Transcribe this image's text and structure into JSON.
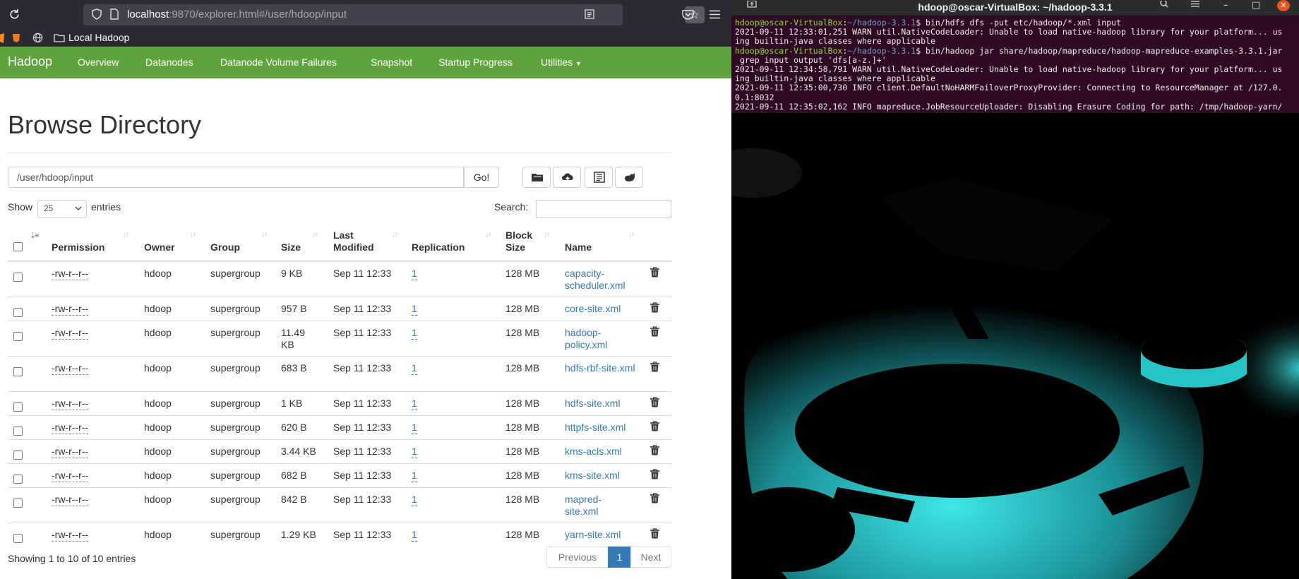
{
  "browser": {
    "url_host": "localhost",
    "url_rest": ":9870/explorer.html#/user/hdoop/input",
    "bookmark_label": "Local Hadoop"
  },
  "nav": {
    "brand": "Hadoop",
    "links": [
      "Overview",
      "Datanodes",
      "Datanode Volume Failures",
      "Snapshot",
      "Startup Progress",
      "Utilities"
    ]
  },
  "page": {
    "title": "Browse Directory",
    "path_value": "/user/hdoop/input",
    "go_label": "Go!",
    "show_label": "Show",
    "entries_select_value": "25",
    "entries_label": "entries",
    "search_label": "Search:"
  },
  "table": {
    "headers": [
      "Permission",
      "Owner",
      "Group",
      "Size",
      "Last Modified",
      "Replication",
      "Block Size",
      "Name"
    ],
    "rows": [
      {
        "permission": "-rw-r--r--",
        "owner": "hdoop",
        "group": "supergroup",
        "size": "9 KB",
        "modified": "Sep 11 12:33",
        "replication": "1",
        "block_size": "128 MB",
        "name": "capacity-scheduler.xml"
      },
      {
        "permission": "-rw-r--r--",
        "owner": "hdoop",
        "group": "supergroup",
        "size": "957 B",
        "modified": "Sep 11 12:33",
        "replication": "1",
        "block_size": "128 MB",
        "name": "core-site.xml"
      },
      {
        "permission": "-rw-r--r--",
        "owner": "hdoop",
        "group": "supergroup",
        "size": "11.49 KB",
        "modified": "Sep 11 12:33",
        "replication": "1",
        "block_size": "128 MB",
        "name": "hadoop-policy.xml"
      },
      {
        "permission": "-rw-r--r--",
        "owner": "hdoop",
        "group": "supergroup",
        "size": "683 B",
        "modified": "Sep 11 12:33",
        "replication": "1",
        "block_size": "128 MB",
        "name": "hdfs-rbf-site.xml"
      },
      {
        "permission": "-rw-r--r--",
        "owner": "hdoop",
        "group": "supergroup",
        "size": "1 KB",
        "modified": "Sep 11 12:33",
        "replication": "1",
        "block_size": "128 MB",
        "name": "hdfs-site.xml"
      },
      {
        "permission": "-rw-r--r--",
        "owner": "hdoop",
        "group": "supergroup",
        "size": "620 B",
        "modified": "Sep 11 12:33",
        "replication": "1",
        "block_size": "128 MB",
        "name": "httpfs-site.xml"
      },
      {
        "permission": "-rw-r--r--",
        "owner": "hdoop",
        "group": "supergroup",
        "size": "3.44 KB",
        "modified": "Sep 11 12:33",
        "replication": "1",
        "block_size": "128 MB",
        "name": "kms-acls.xml"
      },
      {
        "permission": "-rw-r--r--",
        "owner": "hdoop",
        "group": "supergroup",
        "size": "682 B",
        "modified": "Sep 11 12:33",
        "replication": "1",
        "block_size": "128 MB",
        "name": "kms-site.xml"
      },
      {
        "permission": "-rw-r--r--",
        "owner": "hdoop",
        "group": "supergroup",
        "size": "842 B",
        "modified": "Sep 11 12:33",
        "replication": "1",
        "block_size": "128 MB",
        "name": "mapred-site.xml"
      },
      {
        "permission": "-rw-r--r--",
        "owner": "hdoop",
        "group": "supergroup",
        "size": "1.29 KB",
        "modified": "Sep 11 12:33",
        "replication": "1",
        "block_size": "128 MB",
        "name": "yarn-site.xml"
      }
    ]
  },
  "footer": {
    "info": "Showing 1 to 10 of 10 entries",
    "prev": "Previous",
    "page": "1",
    "next": "Next"
  },
  "terminal": {
    "title": "hdoop@oscar-VirtualBox: ~/hadoop-3.3.1",
    "prompt_user": "hdoop@oscar-VirtualBox",
    "prompt_path": "~/hadoop-3.3.1",
    "cmd1": "$ bin/hdfs dfs -put etc/hadoop/*.xml input",
    "out1": "2021-09-11 12:33:01,251 WARN util.NativeCodeLoader: Unable to load native-hadoop library for your platform... us",
    "out2": "ing builtin-java classes where applicable",
    "cmd2": "$ bin/hadoop jar share/hadoop/mapreduce/hadoop-mapreduce-examples-3.3.1.jar",
    "cmd2b": " grep input output 'dfs[a-z.]+'",
    "out3": "2021-09-11 12:34:58,791 WARN util.NativeCodeLoader: Unable to load native-hadoop library for your platform... us",
    "out4": "ing builtin-java classes where applicable",
    "out5": "2021-09-11 12:35:00,730 INFO client.DefaultNoHARMFailoverProxyProvider: Connecting to ResourceManager at /127.0.",
    "out6": "0.1:8032",
    "out7": "2021-09-11 12:35:02,162 INFO mapreduce.JobResourceUploader: Disabling Erasure Coding for path: /tmp/hadoop-yarn/"
  },
  "colors": {
    "hadoop_green": "#5fa33e",
    "link_blue": "#337ab7",
    "terminal_bg": "#300a24",
    "wallpaper_cyan": "#3ee6e6"
  },
  "icons": [
    "reload-icon",
    "shield-icon",
    "page-icon",
    "reader-icon",
    "star-icon",
    "pocket-icon",
    "menu-icon",
    "folder-icon",
    "globe-icon",
    "new-folder-icon",
    "upload-icon",
    "cut-paste-icon",
    "trash-icon"
  ]
}
